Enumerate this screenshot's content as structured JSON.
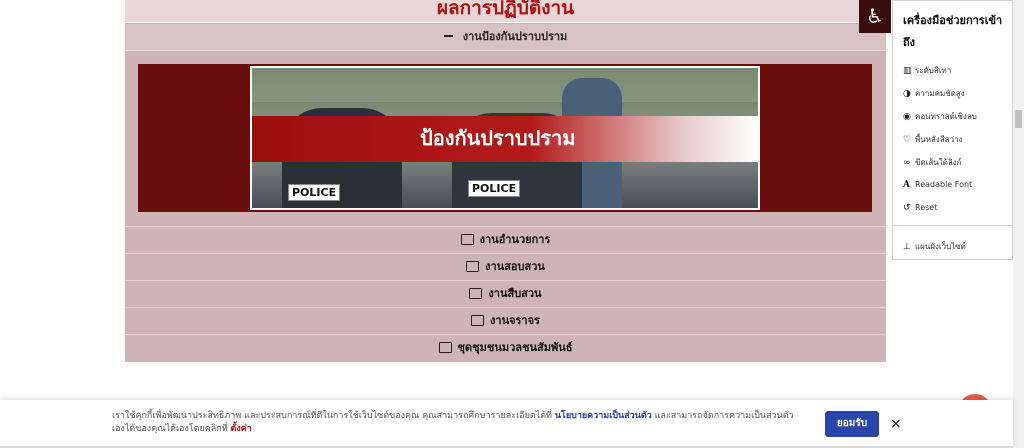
{
  "page": {
    "title": "ผลการปฏิบัติงาน"
  },
  "section": {
    "header": "งานป้องกันปราบปราม",
    "banner_text": "ป้องกันปราบปราม",
    "police_label": "POLICE"
  },
  "menu": [
    {
      "label": "งานอำนวยการ"
    },
    {
      "label": "งานสอบสวน"
    },
    {
      "label": "งานสืบสวน"
    },
    {
      "label": "งานจราจร"
    },
    {
      "label": "ชุดชุมชนมวลชนสัมพันธ์"
    }
  ],
  "accessibility": {
    "title": "เครื่องมือช่วยการเข้าถึง",
    "items": [
      {
        "label": "ระดับสีเทา",
        "icon": "grayscale-icon"
      },
      {
        "label": "ความคมชัดสูง",
        "icon": "contrast-icon"
      },
      {
        "label": "คอนทราสต์เชิงลบ",
        "icon": "eye-icon"
      },
      {
        "label": "พื้นหลังสีสว่าง",
        "icon": "bulb-icon"
      },
      {
        "label": "ขีดเส้นใต้ลิงก์",
        "icon": "link-icon"
      },
      {
        "label": "Readable Font",
        "icon": "font-icon"
      },
      {
        "label": "Reset",
        "icon": "reset-icon"
      }
    ],
    "sitemap": "แผนผังเว็บไซต์"
  },
  "cookie": {
    "text_before": "เราใช้คุกกี้เพื่อพัฒนาประสิทธิภาพ และประสบการณ์ที่ดีในการใช้เว็บไซต์ของคุณ คุณสามารถศึกษารายละเอียดได้ที่ ",
    "policy_link": "นโยบายความเป็นส่วนตัว",
    "text_after": " และสามารถจัดการความเป็นส่วนตัวเองได้ของคุณได้เองโดยคลิกที่ ",
    "settings_link": "ตั้งค่า",
    "accept": "ยอมรับ",
    "close": "×"
  },
  "colors": {
    "title": "#b01010",
    "panel": "#ceb4b6",
    "banner": "#6a0d0d",
    "accept": "#2b45a8"
  }
}
